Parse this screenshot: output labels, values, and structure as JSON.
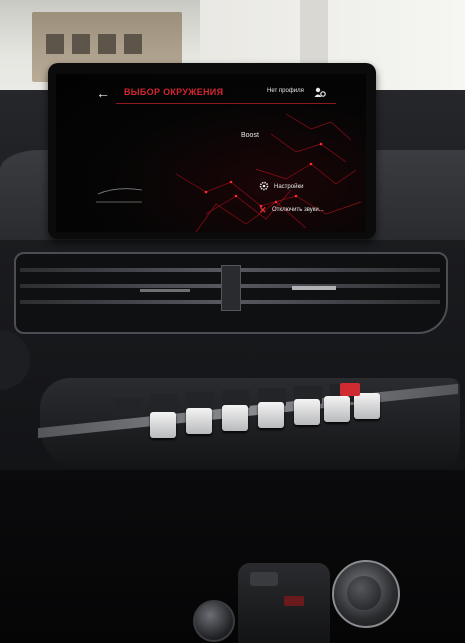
{
  "screen": {
    "title": "ВЫБОР ОКРУЖЕНИЯ",
    "profile_label": "Нет профиля",
    "back_icon": "back-arrow-icon",
    "profile_icon": "profile-icon",
    "mode_label": "Boost",
    "menu": {
      "settings_label": "Настройки",
      "settings_icon": "gear-icon",
      "mute_label": "Отключить звуки...",
      "mute_icon": "close-icon"
    },
    "accent_color": "#d5262f"
  }
}
